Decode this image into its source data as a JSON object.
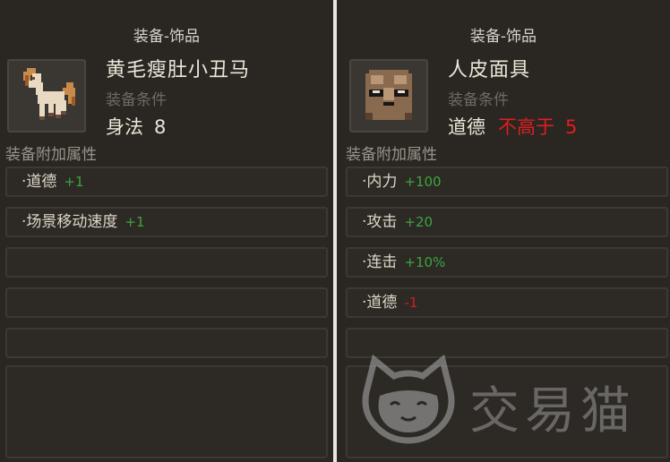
{
  "left": {
    "header": "装备-饰品",
    "item_name": "黄毛瘦肚小丑马",
    "condition_label": "装备条件",
    "requirement": {
      "stat": "身法",
      "value": "8"
    },
    "attr_title": "装备附加属性",
    "attributes": [
      {
        "name": "·道德",
        "bonus": "+1"
      },
      {
        "name": "·场景移动速度",
        "bonus": "+1"
      }
    ],
    "icon": "horse-icon"
  },
  "right": {
    "header": "装备-饰品",
    "item_name": "人皮面具",
    "condition_label": "装备条件",
    "requirement": {
      "stat": "道德",
      "op": "不高于",
      "value": "5"
    },
    "attr_title": "装备附加属性",
    "attributes": [
      {
        "name": "·内力",
        "bonus": "+100"
      },
      {
        "name": "·攻击",
        "bonus": "+20"
      },
      {
        "name": "·连击",
        "bonus": "+10%"
      },
      {
        "name": "·道德",
        "bonus": "-1"
      }
    ],
    "icon": "mask-icon"
  },
  "watermark": {
    "text": "交易猫",
    "icon": "cat-logo-icon"
  },
  "colors": {
    "positive": "#3da43d",
    "negative": "#d12020",
    "background": "#2a2622"
  }
}
